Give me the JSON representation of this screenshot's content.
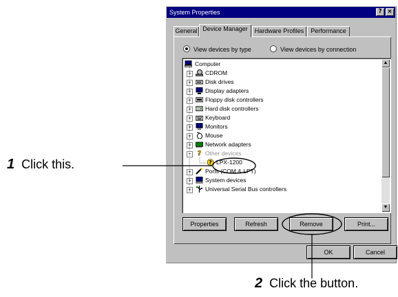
{
  "dialog": {
    "title": "System Properties",
    "help_label": "?",
    "close_label": "×",
    "tabs": [
      {
        "label": "General"
      },
      {
        "label": "Device Manager"
      },
      {
        "label": "Hardware Profiles"
      },
      {
        "label": "Performance"
      }
    ],
    "radio_by_type": "View devices by type",
    "radio_by_connection": "View devices by connection",
    "devices": [
      {
        "label": "Computer"
      },
      {
        "label": "CDROM"
      },
      {
        "label": "Disk drives"
      },
      {
        "label": "Display adapters"
      },
      {
        "label": "Floppy disk controllers"
      },
      {
        "label": "Hard disk controllers"
      },
      {
        "label": "Keyboard"
      },
      {
        "label": "Monitors"
      },
      {
        "label": "Mouse"
      },
      {
        "label": "Network adapters"
      },
      {
        "label": "Other devices"
      },
      {
        "label": "LPX-1200"
      },
      {
        "label": "Ports (COM & LPT)"
      },
      {
        "label": "System devices"
      },
      {
        "label": "Universal Serial Bus controllers"
      }
    ],
    "buttons": {
      "properties": "Properties",
      "refresh": "Refresh",
      "remove": "Remove",
      "print": "Print...",
      "ok": "OK",
      "cancel": "Cancel"
    }
  },
  "annotations": {
    "step1_number": "1",
    "step1_text": "Click this.",
    "step2_number": "2",
    "step2_text": "Click the button."
  },
  "colors": {
    "titlebar": "#000080",
    "window_face": "#c0c0c0",
    "warning_icon": "#ffd800"
  }
}
